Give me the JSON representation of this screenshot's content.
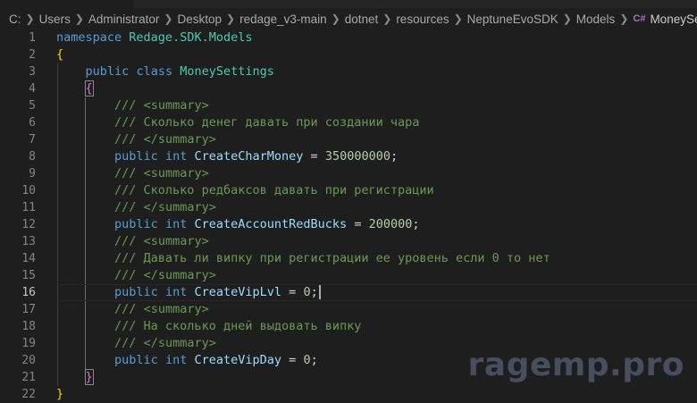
{
  "breadcrumb": {
    "items": [
      "C:",
      "Users",
      "Administrator",
      "Desktop",
      "redage_v3-main",
      "dotnet",
      "resources",
      "NeptuneEvoSDK",
      "Models"
    ],
    "file_icon": "C#",
    "file": "MoneySettings.cs"
  },
  "editor": {
    "active_line": 16,
    "line_numbers": [
      "1",
      "2",
      "3",
      "4",
      "5",
      "6",
      "7",
      "8",
      "9",
      "10",
      "11",
      "12",
      "13",
      "14",
      "15",
      "16",
      "17",
      "18",
      "19",
      "20",
      "21",
      "22"
    ],
    "code": {
      "l1": {
        "kw": "namespace",
        "ns": "Redage.SDK.Models"
      },
      "l2": {
        "brace": "{"
      },
      "l3": {
        "kw1": "public",
        "kw2": "class",
        "name": "MoneySettings"
      },
      "l4": {
        "brace": "{"
      },
      "l5": {
        "slashes": "///",
        "tag": "<summary>"
      },
      "l6": {
        "text": "/// Сколько денег давать при создании чара"
      },
      "l7": {
        "slashes": "///",
        "tag": "</summary>"
      },
      "l8": {
        "kw1": "public",
        "kw2": "int",
        "name": "CreateCharMoney",
        "op": "=",
        "value": "350000000",
        "end": ";"
      },
      "l9": {
        "slashes": "///",
        "tag": "<summary>"
      },
      "l10": {
        "text": "/// Сколько редбаксов давать при регистрации"
      },
      "l11": {
        "slashes": "///",
        "tag": "</summary>"
      },
      "l12": {
        "kw1": "public",
        "kw2": "int",
        "name": "CreateAccountRedBucks",
        "op": "=",
        "value": "200000",
        "end": ";"
      },
      "l13": {
        "slashes": "///",
        "tag": "<summary>"
      },
      "l14": {
        "text": "/// Давать ли випку при регистрации ее уровень если 0 то нет"
      },
      "l15": {
        "slashes": "///",
        "tag": "</summary>"
      },
      "l16": {
        "kw1": "public",
        "kw2": "int",
        "name": "CreateVipLvl",
        "op": "=",
        "value": "0",
        "end": ";"
      },
      "l17": {
        "slashes": "///",
        "tag": "<summary>"
      },
      "l18": {
        "text": "/// На сколько дней выдовать випку"
      },
      "l19": {
        "slashes": "///",
        "tag": "</summary>"
      },
      "l20": {
        "kw1": "public",
        "kw2": "int",
        "name": "CreateVipDay",
        "op": "=",
        "value": "0",
        "end": ";"
      },
      "l21": {
        "brace": "}"
      },
      "l22": {
        "brace": "}"
      }
    }
  },
  "watermark": "ragemp.pro",
  "colors": {
    "background": "#1e1e1e",
    "keyword": "#569cd6",
    "type": "#4ec9b0",
    "comment": "#6a9955",
    "number": "#b5cea8",
    "bracket_outer": "#ffd700",
    "bracket_inner": "#da70d6"
  }
}
